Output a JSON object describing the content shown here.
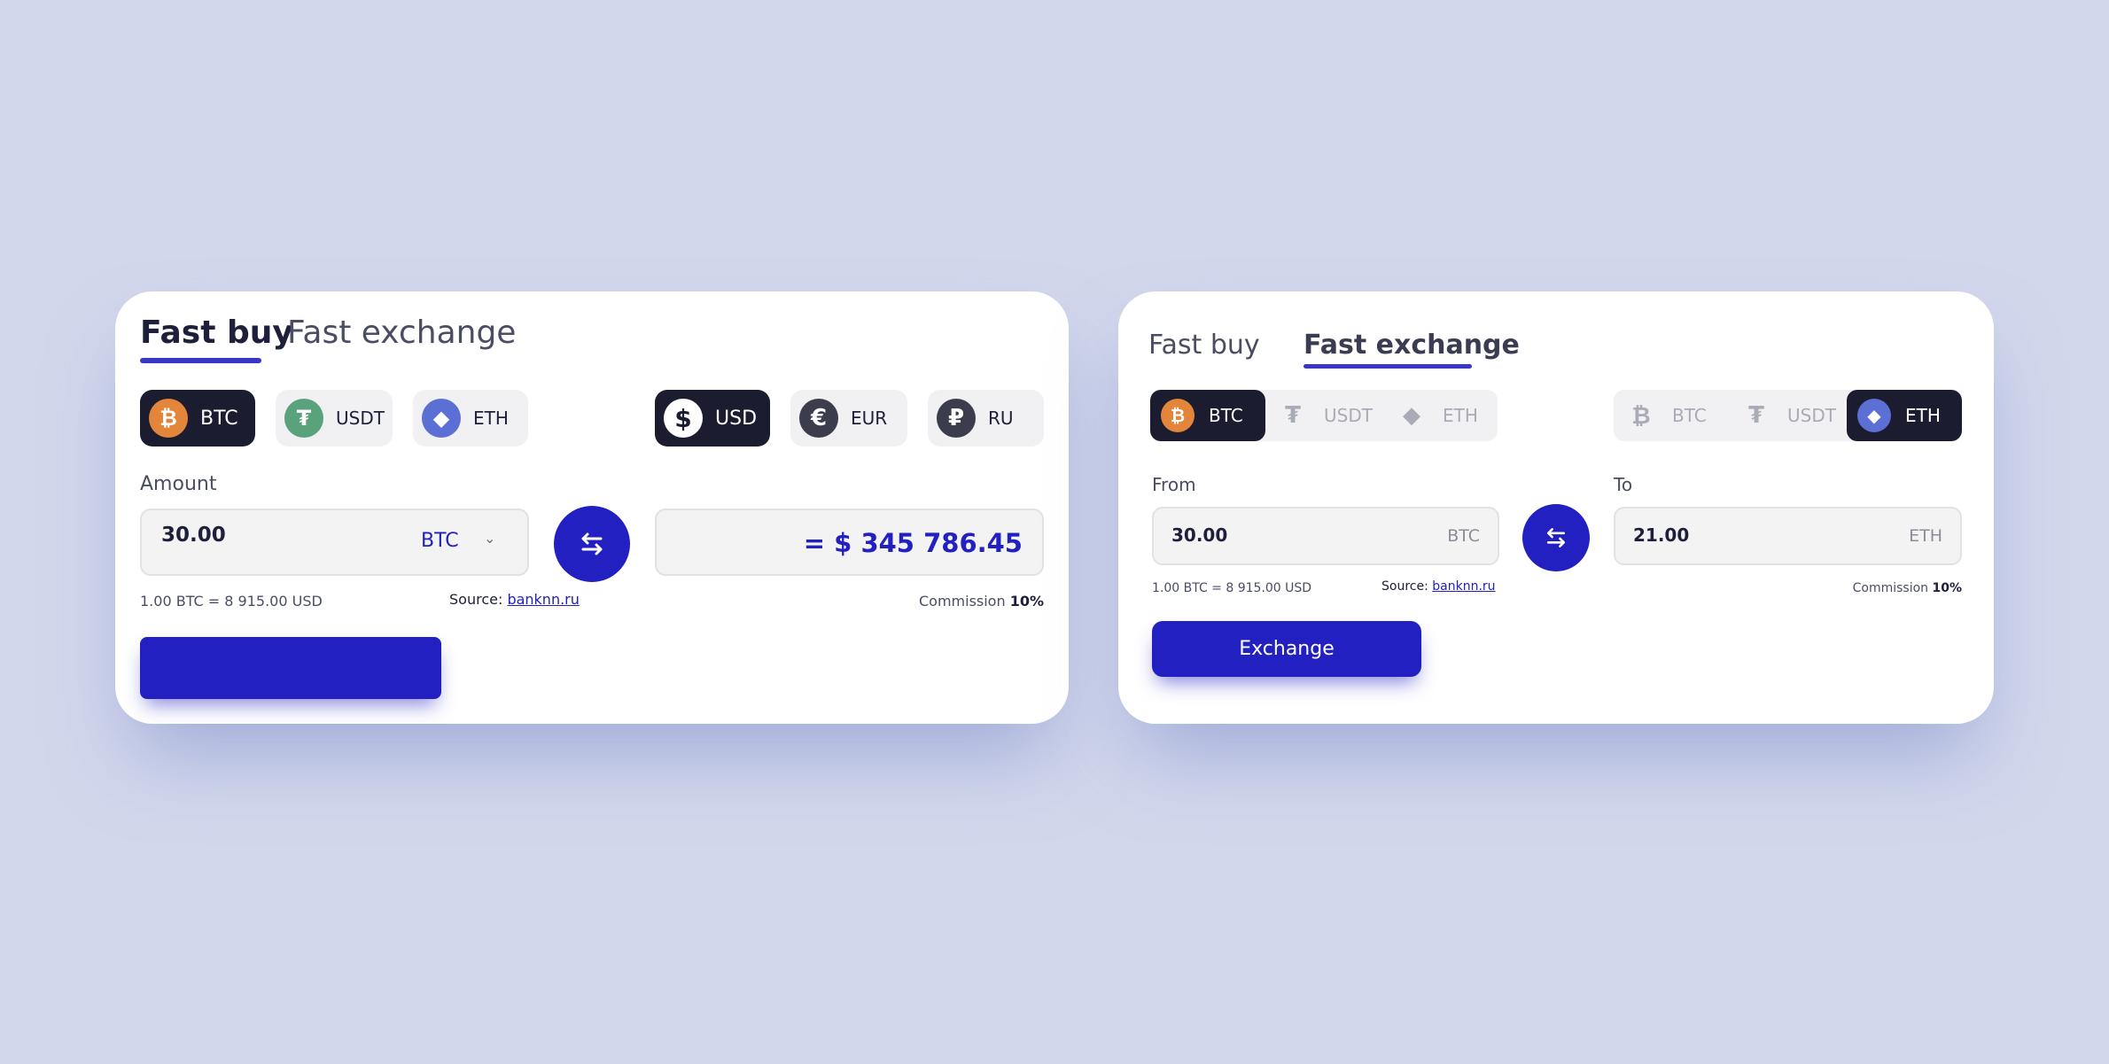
{
  "colors": {
    "background": "#d2d7ec",
    "accent": "#2320c2",
    "dark_chip": "#1c1c30",
    "btc": "#e3853a",
    "usdt": "#5aa27c",
    "eth": "#5b6fd4"
  },
  "buy_widget": {
    "tabs": [
      {
        "label": "Fast buy",
        "active": true
      },
      {
        "label": "Fast exchange",
        "active": false
      }
    ],
    "crypto": [
      {
        "label": "BTC",
        "icon": "bitcoin-icon",
        "glyph": "₿",
        "selected": true
      },
      {
        "label": "USDT",
        "icon": "tether-icon",
        "glyph": "₮",
        "selected": false
      },
      {
        "label": "ETH",
        "icon": "ethereum-icon",
        "glyph": "◆",
        "selected": false
      }
    ],
    "fiat": [
      {
        "label": "USD",
        "icon": "dollar-icon",
        "glyph": "$",
        "selected": true
      },
      {
        "label": "EUR",
        "icon": "euro-icon",
        "glyph": "€",
        "selected": false
      },
      {
        "label": "RU",
        "icon": "ruble-icon",
        "glyph": "₽",
        "selected": false
      }
    ],
    "amount_label": "Amount",
    "amount_value": "30.00",
    "amount_currency": "BTC",
    "result": "= $ 345 786.45",
    "rate": "1.00 BTC =  8 915.00 USD",
    "source_label": "Source:",
    "source_link": "banknn.ru",
    "commission_label": "Commission",
    "commission_value": "10%",
    "button_label": ""
  },
  "exchange_widget": {
    "tabs": [
      {
        "label": "Fast buy",
        "active": false
      },
      {
        "label": "Fast exchange",
        "active": true
      }
    ],
    "from_options": [
      {
        "label": "BTC",
        "icon": "bitcoin-icon",
        "glyph": "₿",
        "selected": true
      },
      {
        "label": "USDT",
        "icon": "tether-icon",
        "glyph": "₮",
        "selected": false
      },
      {
        "label": "ETH",
        "icon": "ethereum-icon",
        "glyph": "◆",
        "selected": false
      }
    ],
    "to_options": [
      {
        "label": "BTC",
        "icon": "bitcoin-icon",
        "glyph": "₿",
        "selected": false
      },
      {
        "label": "USDT",
        "icon": "tether-icon",
        "glyph": "₮",
        "selected": false
      },
      {
        "label": "ETH",
        "icon": "ethereum-icon",
        "glyph": "◆",
        "selected": true
      }
    ],
    "from_label": "From",
    "from_value": "30.00",
    "from_currency": "BTC",
    "to_label": "To",
    "to_value": "21.00",
    "to_currency": "ETH",
    "rate": "1.00 BTC =  8 915.00 USD",
    "source_label": "Source:",
    "source_link": "banknn.ru",
    "commission_label": "Commission",
    "commission_value": "10%",
    "button_label": "Exchange"
  }
}
